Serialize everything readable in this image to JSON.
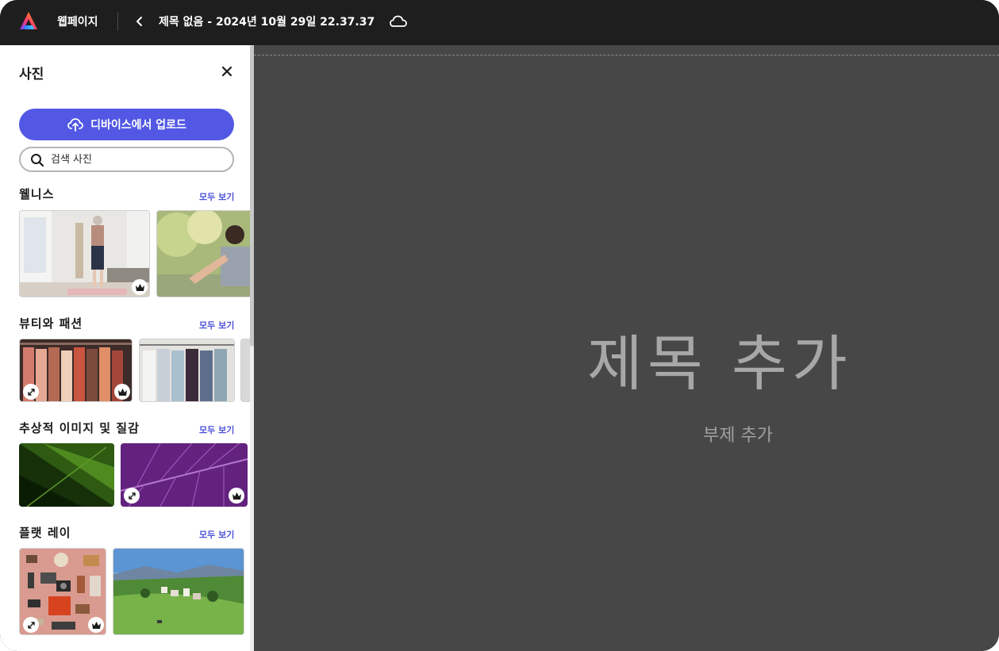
{
  "topbar": {
    "app_name": "웹페이지",
    "doc_title": "제목 없음 - 2024년 10월 29일 22.37.37",
    "icons": [
      "adobe-express-logo",
      "back-chevron-icon",
      "cloud-icon"
    ]
  },
  "panel": {
    "title": "사진",
    "upload_label": "디바이스에서 업로드",
    "search_placeholder": "검색 사진",
    "sections": [
      {
        "title": "웰니스",
        "view_all": "모두 보기"
      },
      {
        "title": "뷰티와 패션",
        "view_all": "모두 보기"
      },
      {
        "title": "추상적 이미지 및 질감",
        "view_all": "모두 보기"
      },
      {
        "title": "플랫 레이",
        "view_all": "모두 보기"
      }
    ]
  },
  "canvas": {
    "title": "제목 추가",
    "subtitle": "부제 추가"
  },
  "colors": {
    "accent": "#5258e4",
    "link": "#4b50d8",
    "topbar_bg": "#1e1e1e",
    "canvas_bg": "#474747"
  }
}
